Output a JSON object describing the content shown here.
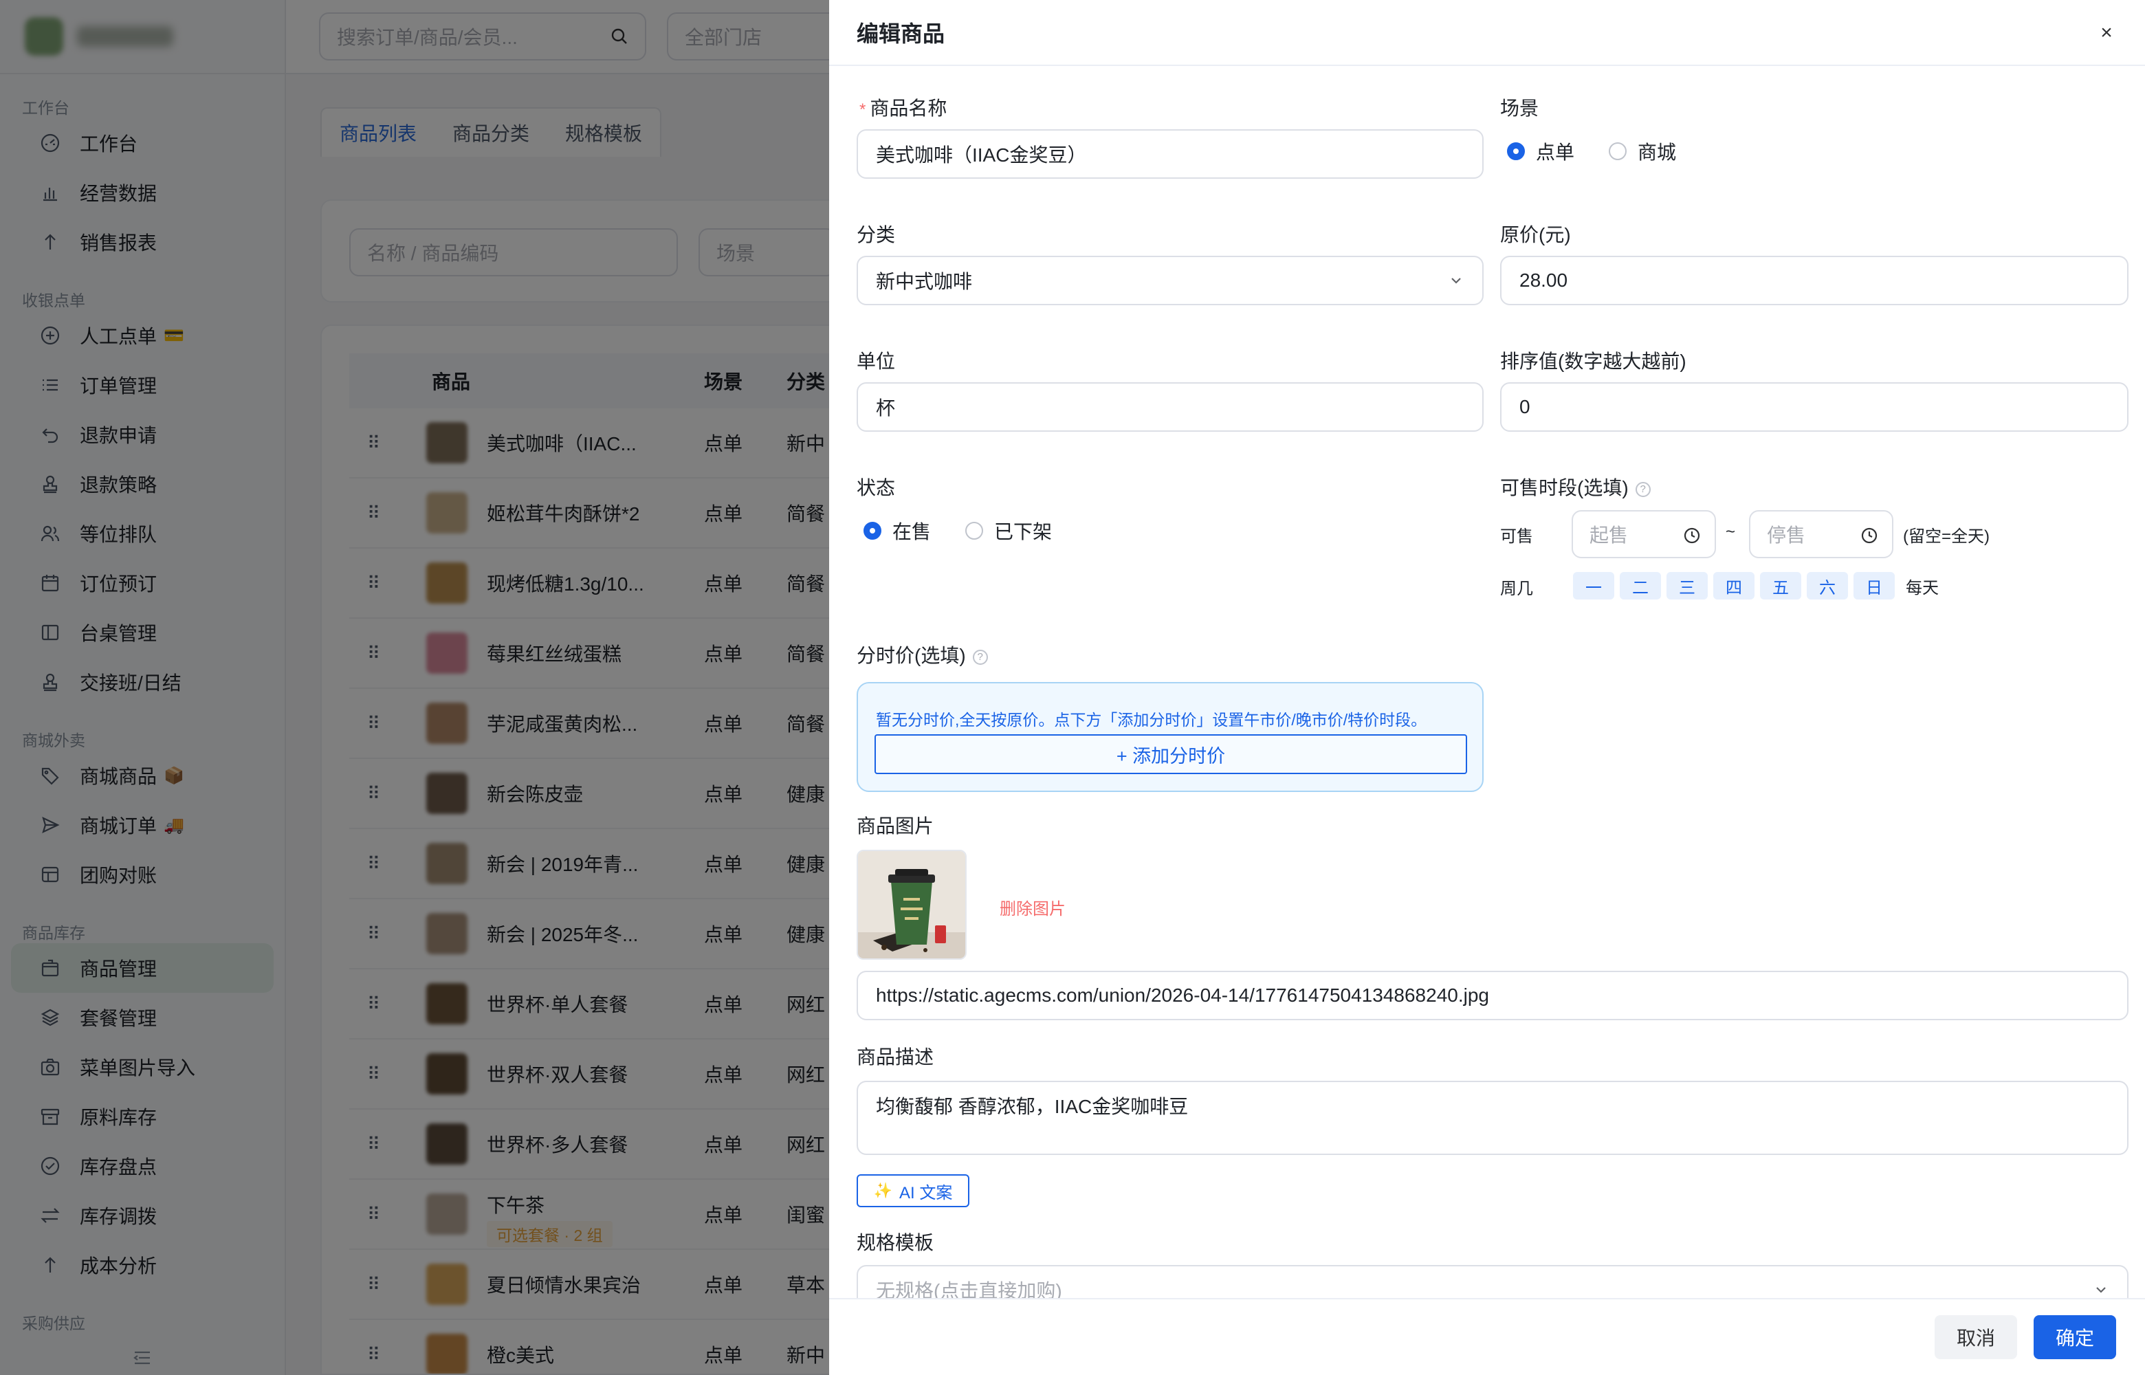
{
  "sidebar": {
    "groups": [
      {
        "label": "工作台",
        "items": [
          {
            "label": "工作台",
            "icon": "dashboard-icon"
          },
          {
            "label": "经营数据",
            "icon": "bar-chart-icon"
          },
          {
            "label": "销售报表",
            "icon": "arrow-up-icon"
          }
        ]
      },
      {
        "label": "收银点单",
        "items": [
          {
            "label": "人工点单",
            "icon": "plus-circle-icon",
            "suffix": "💳"
          },
          {
            "label": "订单管理",
            "icon": "list-icon"
          },
          {
            "label": "退款申请",
            "icon": "undo-icon"
          },
          {
            "label": "退款策略",
            "icon": "stamp-icon"
          },
          {
            "label": "等位排队",
            "icon": "users-icon"
          },
          {
            "label": "订位预订",
            "icon": "calendar-icon"
          },
          {
            "label": "台桌管理",
            "icon": "layout-icon"
          },
          {
            "label": "交接班/日结",
            "icon": "stamp-icon"
          }
        ]
      },
      {
        "label": "商城外卖",
        "items": [
          {
            "label": "商城商品",
            "icon": "tag-icon",
            "suffix": "📦"
          },
          {
            "label": "商城订单",
            "icon": "send-icon",
            "suffix": "🚚"
          },
          {
            "label": "团购对账",
            "icon": "ticket-icon"
          }
        ]
      },
      {
        "label": "商品库存",
        "items": [
          {
            "label": "商品管理",
            "icon": "box-icon",
            "active": true
          },
          {
            "label": "套餐管理",
            "icon": "layers-icon"
          },
          {
            "label": "菜单图片导入",
            "icon": "camera-icon"
          },
          {
            "label": "原料库存",
            "icon": "archive-icon"
          },
          {
            "label": "库存盘点",
            "icon": "check-circle-icon"
          },
          {
            "label": "库存调拨",
            "icon": "swap-icon"
          },
          {
            "label": "成本分析",
            "icon": "arrow-up-icon"
          }
        ]
      },
      {
        "label": "采购供应",
        "items": []
      }
    ]
  },
  "topbar": {
    "search_placeholder": "搜索订单/商品/会员...",
    "store_select": "全部门店"
  },
  "page_tabs": [
    {
      "label": "商品列表",
      "active": true
    },
    {
      "label": "商品分类",
      "active": false
    },
    {
      "label": "规格模板",
      "active": false
    }
  ],
  "filters": {
    "name_placeholder": "名称 / 商品编码",
    "scene_placeholder": "场景"
  },
  "table": {
    "headers": {
      "name": "商品",
      "scene": "场景",
      "category": "分类"
    },
    "rows": [
      {
        "name": "美式咖啡（IIAC...",
        "scene": "点单",
        "category": "新中",
        "thumb": "#7f6e58"
      },
      {
        "name": "姬松茸牛肉酥饼*2",
        "scene": "点单",
        "category": "简餐",
        "thumb": "#c9b08b"
      },
      {
        "name": "现烤低糖1.3g/10...",
        "scene": "点单",
        "category": "简餐",
        "thumb": "#b98d4e"
      },
      {
        "name": "莓果红丝绒蛋糕",
        "scene": "点单",
        "category": "简餐",
        "thumb": "#d9889a"
      },
      {
        "name": "芋泥咸蛋黄肉松...",
        "scene": "点单",
        "category": "简餐",
        "thumb": "#b08766"
      },
      {
        "name": "新会陈皮壶",
        "scene": "点单",
        "category": "健康",
        "thumb": "#6e5a4a"
      },
      {
        "name": "新会 | 2019年青...",
        "scene": "点单",
        "category": "健康",
        "thumb": "#a08a70"
      },
      {
        "name": "新会 | 2025年冬...",
        "scene": "点单",
        "category": "健康",
        "thumb": "#a8907a"
      },
      {
        "name": "世界杯·单人套餐",
        "scene": "点单",
        "category": "网红",
        "thumb": "#6a5238"
      },
      {
        "name": "世界杯·双人套餐",
        "scene": "点单",
        "category": "网红",
        "thumb": "#5e4a34"
      },
      {
        "name": "世界杯·多人套餐",
        "scene": "点单",
        "category": "网红",
        "thumb": "#5a4a3a"
      },
      {
        "name": "下午茶",
        "scene": "点单",
        "category": "闺蜜",
        "thumb": "#b8a898",
        "tag": "可选套餐 · 2 组"
      },
      {
        "name": "夏日倾情水果宾治",
        "scene": "点单",
        "category": "草本",
        "thumb": "#d9a65a"
      },
      {
        "name": "橙c美式",
        "scene": "点单",
        "category": "新中",
        "thumb": "#c68a48"
      }
    ]
  },
  "drawer": {
    "title": "编辑商品",
    "close_label": "×",
    "fields": {
      "name": {
        "label": "商品名称",
        "value": "美式咖啡（IIAC金奖豆）"
      },
      "scene": {
        "label": "场景",
        "options": [
          "点单",
          "商城"
        ],
        "selected": "点单"
      },
      "category": {
        "label": "分类",
        "value": "新中式咖啡"
      },
      "price": {
        "label": "原价(元)",
        "value": "28.00"
      },
      "unit": {
        "label": "单位",
        "value": "杯"
      },
      "sort": {
        "label": "排序值(数字越大越前)",
        "value": "0"
      },
      "status": {
        "label": "状态",
        "options": [
          "在售",
          "已下架"
        ],
        "selected": "在售"
      },
      "sale_time": {
        "label": "可售时段(选填)",
        "row_label": "可售",
        "start_placeholder": "起售",
        "separator": "~",
        "end_placeholder": "停售",
        "hint": "(留空=全天)",
        "week_label": "周几",
        "weekdays": [
          "一",
          "二",
          "三",
          "四",
          "五",
          "六",
          "日"
        ],
        "everyday_label": "每天"
      },
      "time_price": {
        "label": "分时价(选填)",
        "info": "暂无分时价,全天按原价。点下方「添加分时价」设置午市价/晚市价/特价时段。",
        "add_button": "+ 添加分时价"
      },
      "image": {
        "label": "商品图片",
        "delete_label": "删除图片",
        "url": "https://static.agecms.com/union/2026-04-14/1776147504134868240.jpg"
      },
      "description": {
        "label": "商品描述",
        "value": "均衡馥郁 香醇浓郁，IIAC金奖咖啡豆"
      },
      "ai_button": "AI 文案",
      "spec": {
        "label": "规格模板",
        "placeholder": "无规格(点击直接加购)"
      }
    },
    "footer": {
      "cancel": "取消",
      "confirm": "确定"
    }
  },
  "colors": {
    "primary": "#1a63e6",
    "danger": "#f56c6c",
    "active_nav_bg": "#e3efe9"
  }
}
